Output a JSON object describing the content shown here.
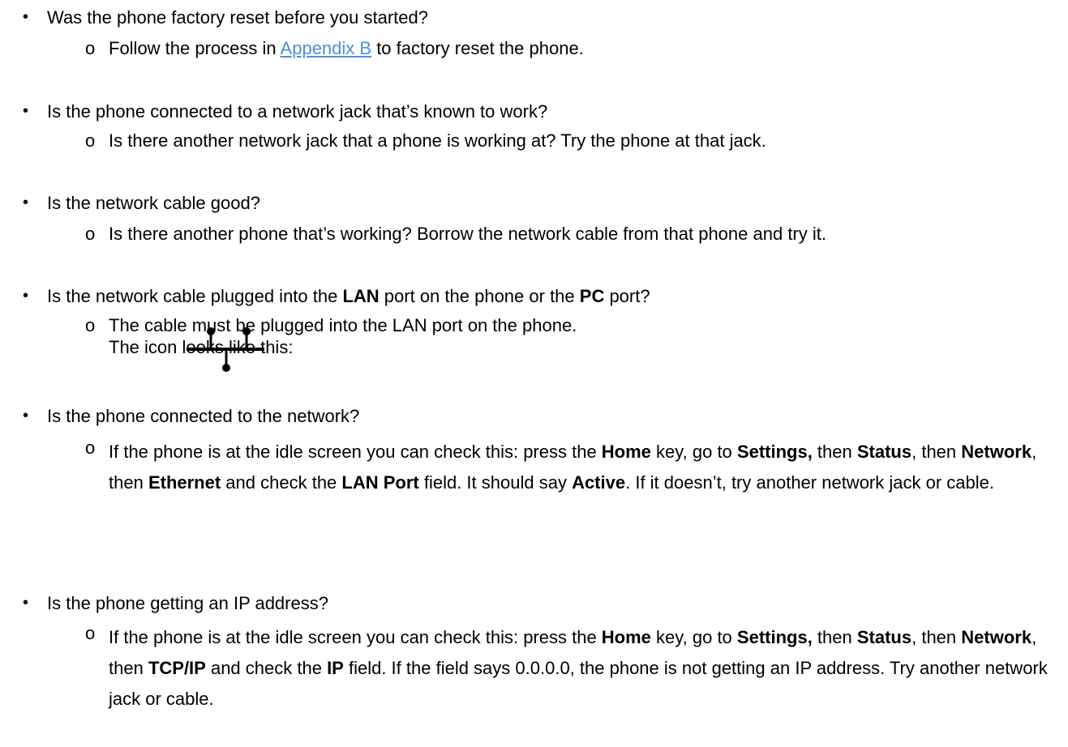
{
  "q1": {
    "q": "Was the phone factory reset before you started?",
    "a_pre": "Follow the process in ",
    "a_link": "Appendix B",
    "a_post": " to factory reset the phone."
  },
  "q2": {
    "q": "Is the phone connected to a network jack that’s known to work?",
    "a": "Is there another network jack that a phone is working at? Try the phone at that jack."
  },
  "q3": {
    "q": "Is the network cable good?",
    "a": "Is there another phone that’s working? Borrow the network cable from that phone and try it."
  },
  "q4": {
    "q1": "Is the network cable plugged into the ",
    "q_lan": "LAN",
    "q2": " port on the phone or the ",
    "q_pc": "PC",
    "q3": " port?",
    "a1": "The cable must be plugged into the LAN port on the phone.",
    "a2": "The icon looks like this:"
  },
  "q5": {
    "q": "Is the phone connected to the network?",
    "a1": "If the phone is at the idle screen you can check this: press the ",
    "home": "Home",
    "a2": " key, go to ",
    "settings": "Settings,",
    "a3": " then ",
    "status": "Status",
    "a4": ", then ",
    "network": "Network",
    "a5": ", then ",
    "ethernet": "Ethernet",
    "a6": " and check the ",
    "lanport": "LAN Port",
    "a7": " field. It should say ",
    "active": "Active",
    "a8": ". If it doesn’t, try another network jack or cable."
  },
  "q6": {
    "q": "Is the phone getting an IP address?",
    "a1": "If the phone is at the idle screen you can check this: press the ",
    "home": "Home",
    "a2": " key, go to ",
    "settings": "Settings,",
    "a3": " then ",
    "status": "Status",
    "a4": ", then ",
    "network": "Network",
    "a5": ", then ",
    "tcpip": "TCP/IP",
    "a6": " and check the ",
    "ip": "IP",
    "a7": " field. If the field says 0.0.0.0, the phone is not getting an IP address. Try another network jack or cable."
  },
  "glyphs": {
    "bullet": "•",
    "sub_bullet": "o"
  },
  "colors": {
    "link": "#4f8fd9"
  }
}
